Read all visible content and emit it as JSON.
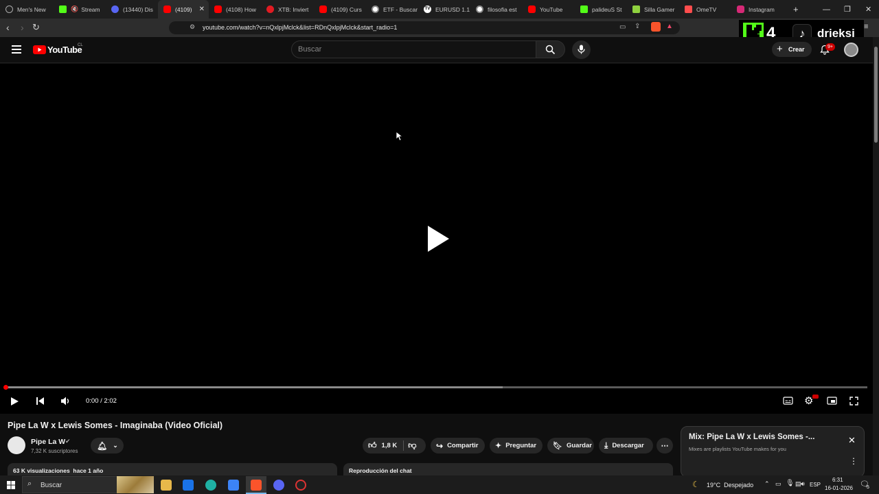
{
  "browser": {
    "tabs": [
      {
        "title": "Men's New",
        "icon": "globe-icon",
        "color": "#d9d9d9"
      },
      {
        "title": "Stream",
        "icon": "kick-icon",
        "color": "#53fc18",
        "muted": true
      },
      {
        "title": "(13440) Dis",
        "icon": "discord-icon",
        "color": "#5865f2"
      },
      {
        "title": "(4109)",
        "icon": "youtube-icon",
        "color": "#ff0000",
        "active": true
      },
      {
        "title": "(4108) How",
        "icon": "youtube-icon",
        "color": "#ff0000"
      },
      {
        "title": "XTB: Inviert",
        "icon": "xtb-icon",
        "color": "#e11b22"
      },
      {
        "title": "(4109) Curs",
        "icon": "youtube-icon",
        "color": "#ff0000"
      },
      {
        "title": "ETF - Buscar",
        "icon": "google-icon",
        "color": "#cfcfcf"
      },
      {
        "title": "EURUSD 1.1",
        "icon": "tradingview-icon",
        "color": "#e6e6e6"
      },
      {
        "title": "filosofia est",
        "icon": "google-icon",
        "color": "#cfcfcf"
      },
      {
        "title": "YouTube",
        "icon": "youtube-icon",
        "color": "#ff0000"
      },
      {
        "title": "palideuS St",
        "icon": "kick-icon",
        "color": "#53fc18"
      },
      {
        "title": "Silla Gamer",
        "icon": "store-icon",
        "color": "#8fd13f"
      },
      {
        "title": "OmeTV",
        "icon": "ometv-icon",
        "color": "#ff4d4d"
      },
      {
        "title": "Instagram",
        "icon": "instagram-icon",
        "color": "#d62976"
      }
    ],
    "new_tab_label": "+",
    "url": "youtube.com/watch?v=nQxlpjMclck&list=RDnQxlpjMclck&start_radio=1"
  },
  "overlay": {
    "badge_number": "4",
    "username": "drieksi"
  },
  "youtube": {
    "logo_text": "YouTube",
    "region": "CL",
    "search_placeholder": "Buscar",
    "create_label": "Crear",
    "notif_count": "9+",
    "player": {
      "time": "0:00 / 2:02",
      "progress_fraction": 0.0,
      "buffered_fraction": 0.577
    },
    "video": {
      "title": "Pipe La W x Lewis Somes - Imaginaba (Video Oficial)",
      "channel": "Pipe La W",
      "subscribers": "7,32 K suscriptores",
      "likes": "1,8 K",
      "share_label": "Compartir",
      "ask_label": "Preguntar",
      "save_label": "Guardar",
      "download_label": "Descargar",
      "views_date": "63 K visualizaciones  hace 1 año",
      "chat_replay": "Reproducción del chat"
    },
    "mix": {
      "title": "Mix: Pipe La W x Lewis Somes -...",
      "subtitle": "Mixes are playlists YouTube makes for you"
    }
  },
  "taskbar": {
    "search_label": "Buscar",
    "weather": "19°C  Despejado",
    "lang": "ESP",
    "time": "6:31",
    "date": "16-01-2026",
    "notif_count": "5"
  }
}
